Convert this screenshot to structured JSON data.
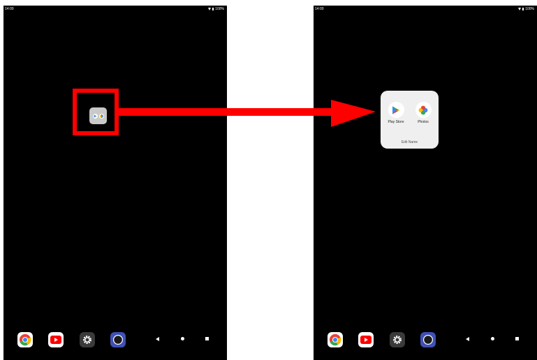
{
  "left_screen": {
    "status": {
      "time": "14:00",
      "battery": "100%"
    },
    "dock": {
      "apps": [
        {
          "name": "chrome"
        },
        {
          "name": "youtube"
        },
        {
          "name": "settings"
        },
        {
          "name": "circle"
        }
      ]
    }
  },
  "right_screen": {
    "status": {
      "time": "14:00",
      "battery": "100%"
    },
    "folder": {
      "apps": [
        {
          "label": "Play Store"
        },
        {
          "label": "Photos"
        }
      ],
      "edit_name_label": "Edit Name"
    }
  },
  "annotation": {
    "highlight_color": "#ff0000",
    "arrow_color": "#ff0000"
  }
}
